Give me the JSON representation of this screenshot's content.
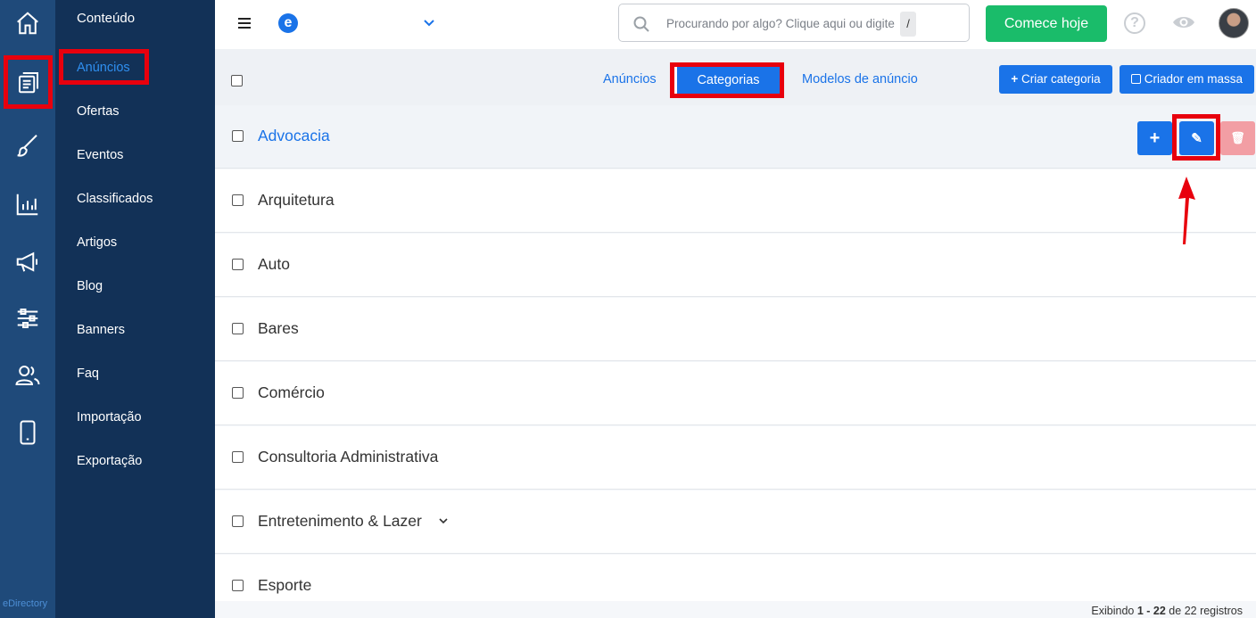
{
  "rail": {
    "items": [
      {
        "icon": "home-icon"
      },
      {
        "icon": "content-icon"
      },
      {
        "icon": "brush-icon"
      },
      {
        "icon": "chart-icon"
      },
      {
        "icon": "megaphone-icon"
      },
      {
        "icon": "sliders-icon"
      },
      {
        "icon": "users-icon"
      },
      {
        "icon": "mobile-icon"
      }
    ],
    "brand": "eDirectory"
  },
  "submenu": {
    "title": "Conteúdo",
    "items": [
      "Anúncios",
      "Ofertas",
      "Eventos",
      "Classificados",
      "Artigos",
      "Blog",
      "Banners",
      "Faq",
      "Importação",
      "Exportação"
    ]
  },
  "topbar": {
    "logo_letter": "e",
    "search_placeholder": "Procurando por algo? Clique aqui ou digite",
    "search_shortcut": "/",
    "cta_label": "Comece hoje",
    "help_symbol": "?"
  },
  "tabs": {
    "items": [
      "Anúncios",
      "Categorias",
      "Modelos de anúncio"
    ],
    "active": "Categorias",
    "create_label": "Criar categoria",
    "bulk_label": "Criador em massa"
  },
  "rows": [
    "Advocacia",
    "Arquitetura",
    "Auto",
    "Bares",
    "Comércio",
    "Consultoria Administrativa",
    "Entretenimento & Lazer",
    "Esporte"
  ],
  "row_actions": {
    "add": "+",
    "edit": "✎",
    "delete": "🗑"
  },
  "footer": {
    "prefix": "Exibindo",
    "range": "1 - 22",
    "middle": "de",
    "suffix": "22 registros"
  },
  "colors": {
    "rail": "#1f4a7a",
    "submenu": "#123157",
    "accent": "#1a73e8",
    "cta": "#1abc6a",
    "highlight": "#e8000d",
    "danger_faded": "#f29ea4"
  }
}
